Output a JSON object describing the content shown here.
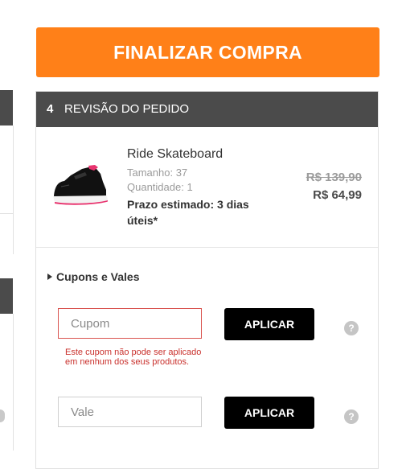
{
  "finalize_button": "FINALIZAR COMPRA",
  "review": {
    "step": "4",
    "title": "REVISÃO DO PEDIDO"
  },
  "product": {
    "name": "Ride Skateboard",
    "size": "Tamanho: 37",
    "quantity": "Quantidade: 1",
    "shipping": "Prazo estimado: 3 dias úteis*",
    "old_price": "R$ 139,90",
    "price": "R$ 64,99",
    "image_icon": "sneaker-image"
  },
  "coupons": {
    "title": "Cupons e Vales",
    "coupon_placeholder": "Cupom",
    "coupon_value": "",
    "coupon_apply": "APLICAR",
    "coupon_error": "Este cupom não pode ser aplicado em nenhum dos seus produtos.",
    "voucher_placeholder": "Vale",
    "voucher_value": "",
    "voucher_apply": "APLICAR",
    "help_glyph": "?"
  },
  "colors": {
    "accent": "#ff8018",
    "header_bg": "#4b4b4b",
    "button_dark": "#000000",
    "error": "#c9302c"
  }
}
